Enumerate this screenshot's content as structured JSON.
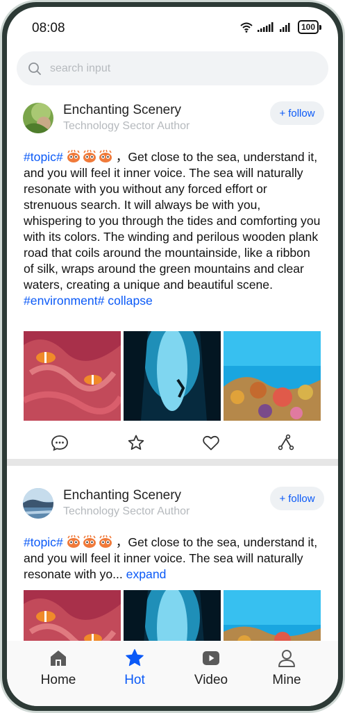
{
  "status_bar": {
    "time": "08:08",
    "battery": "100"
  },
  "search": {
    "placeholder": "search input"
  },
  "posts": [
    {
      "author": "Enchanting Scenery",
      "subtitle": "Technology Sector Author",
      "follow_label": "follow",
      "topic": "#topic#",
      "body": "，Get close to the sea, understand it, and you will feel it inner voice. The sea will naturally resonate with you without any forced effort or strenuous search. It will always be with you, whispering to you through the tides and comforting you with its colors. The winding and perilous wooden plank road that coils around the mountainside, like a ribbon of silk, wraps around the green mountains and clear waters, creating a unique and beautiful scene.",
      "tag": "#environment#",
      "toggle": "collapse"
    },
    {
      "author": "Enchanting Scenery",
      "subtitle": "Technology Sector Author",
      "follow_label": "follow",
      "topic": "#topic#",
      "body": "，Get close to the sea, understand it, and you will feel it inner voice. The sea will naturally resonate with yo...",
      "toggle": "expand"
    }
  ],
  "tabs": [
    {
      "label": "Home",
      "icon": "home-icon"
    },
    {
      "label": "Hot",
      "icon": "star-icon"
    },
    {
      "label": "Video",
      "icon": "video-icon"
    },
    {
      "label": "Mine",
      "icon": "person-icon"
    }
  ],
  "active_tab": "Hot",
  "colors": {
    "accent": "#0a59f7",
    "divider": "#e6e6e6",
    "search_bg": "#f1f3f5"
  }
}
